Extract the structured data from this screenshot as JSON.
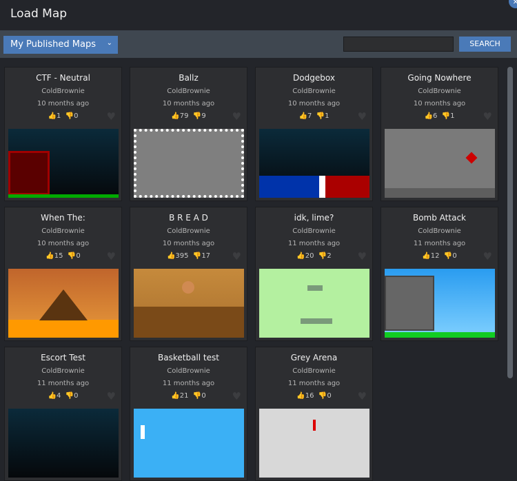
{
  "header": {
    "title": "Load Map"
  },
  "toolbar": {
    "filter": "My Published Maps",
    "search_placeholder": "",
    "search_label": "SEARCH"
  },
  "maps": [
    {
      "title": "CTF - Neutral",
      "author": "ColdBrownie",
      "time": "10 months ago",
      "likes": "1",
      "dislikes": "0"
    },
    {
      "title": "Ballz",
      "author": "ColdBrownie",
      "time": "10 months ago",
      "likes": "79",
      "dislikes": "9"
    },
    {
      "title": "Dodgebox",
      "author": "ColdBrownie",
      "time": "10 months ago",
      "likes": "7",
      "dislikes": "1"
    },
    {
      "title": "Going Nowhere",
      "author": "ColdBrownie",
      "time": "10 months ago",
      "likes": "6",
      "dislikes": "1"
    },
    {
      "title": "When The:",
      "author": "ColdBrownie",
      "time": "10 months ago",
      "likes": "15",
      "dislikes": "0"
    },
    {
      "title": "B R E A D",
      "author": "ColdBrownie",
      "time": "10 months ago",
      "likes": "395",
      "dislikes": "17"
    },
    {
      "title": "idk, lime?",
      "author": "ColdBrownie",
      "time": "11 months ago",
      "likes": "20",
      "dislikes": "2"
    },
    {
      "title": "Bomb Attack",
      "author": "ColdBrownie",
      "time": "11 months ago",
      "likes": "12",
      "dislikes": "0"
    },
    {
      "title": "Escort Test",
      "author": "ColdBrownie",
      "time": "11 months ago",
      "likes": "4",
      "dislikes": "0"
    },
    {
      "title": "Basketball test",
      "author": "ColdBrownie",
      "time": "11 months ago",
      "likes": "21",
      "dislikes": "0"
    },
    {
      "title": "Grey Arena",
      "author": "ColdBrownie",
      "time": "11 months ago",
      "likes": "16",
      "dislikes": "0"
    }
  ],
  "thumbs": [
    "linear-gradient(#0b2a3a,#05080b)",
    "#7f7f7f",
    "linear-gradient(#0b2a3a,#05080b)",
    "#7a7a7a",
    "linear-gradient(#c0652c,#e89a3a)",
    "linear-gradient(#c68a3c,#a8702e)",
    "#b4f0a0",
    "linear-gradient(#2a9cf0,#7fd0ff)",
    "linear-gradient(#0b2a3a,#05080b)",
    "#3bb0f5",
    "#d8d8d8"
  ]
}
